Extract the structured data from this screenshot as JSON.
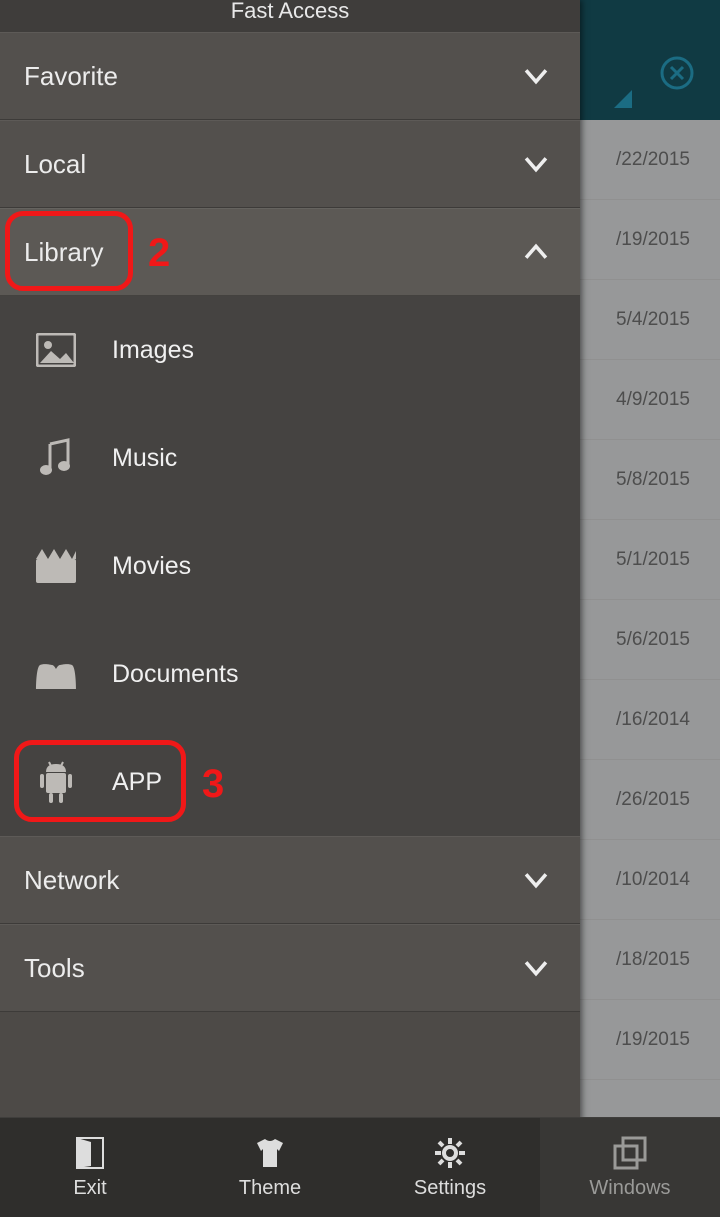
{
  "drawer": {
    "title": "Fast Access",
    "sections": [
      {
        "label": "Favorite",
        "expanded": false
      },
      {
        "label": "Local",
        "expanded": false
      },
      {
        "label": "Library",
        "expanded": true
      },
      {
        "label": "Network",
        "expanded": false
      },
      {
        "label": "Tools",
        "expanded": false
      }
    ],
    "library_items": [
      {
        "label": "Images"
      },
      {
        "label": "Music"
      },
      {
        "label": "Movies"
      },
      {
        "label": "Documents"
      },
      {
        "label": "APP"
      }
    ]
  },
  "background": {
    "dates": [
      "/22/2015",
      "/19/2015",
      "5/4/2015",
      "4/9/2015",
      "5/8/2015",
      "5/1/2015",
      "5/6/2015",
      "/16/2014",
      "/26/2015",
      "/10/2014",
      "/18/2015",
      "/19/2015"
    ]
  },
  "bottom_bar": {
    "exit": "Exit",
    "theme": "Theme",
    "settings": "Settings",
    "windows": "Windows"
  },
  "annotations": {
    "library_num": "2",
    "app_num": "3"
  }
}
